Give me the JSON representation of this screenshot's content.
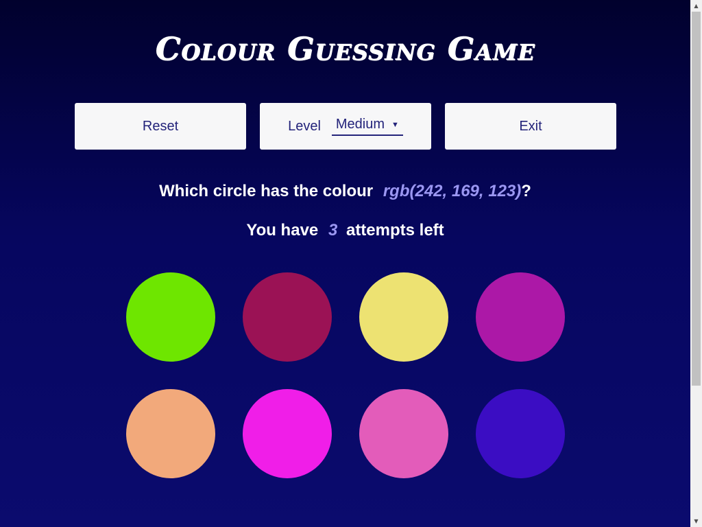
{
  "title": "Colour Guessing Game",
  "controls": {
    "reset_label": "Reset",
    "level_label": "Level",
    "level_value": "Medium",
    "exit_label": "Exit"
  },
  "question": {
    "prefix": "Which circle has the colour",
    "rgb": "rgb(242, 169, 123)",
    "suffix": "?"
  },
  "attempts": {
    "prefix": "You have",
    "count": "3",
    "suffix": "attempts left"
  },
  "circles": [
    {
      "color": "#6ee600"
    },
    {
      "color": "#9b1255"
    },
    {
      "color": "#ede272"
    },
    {
      "color": "#ac18a7"
    },
    {
      "color": "#f2a97b"
    },
    {
      "color": "#f01ee8"
    },
    {
      "color": "#e35cba"
    },
    {
      "color": "#3b0dc3"
    }
  ],
  "colors": {
    "accent": "#9b97f2",
    "button_text": "#23237a",
    "button_bg": "#f7f7f8"
  }
}
